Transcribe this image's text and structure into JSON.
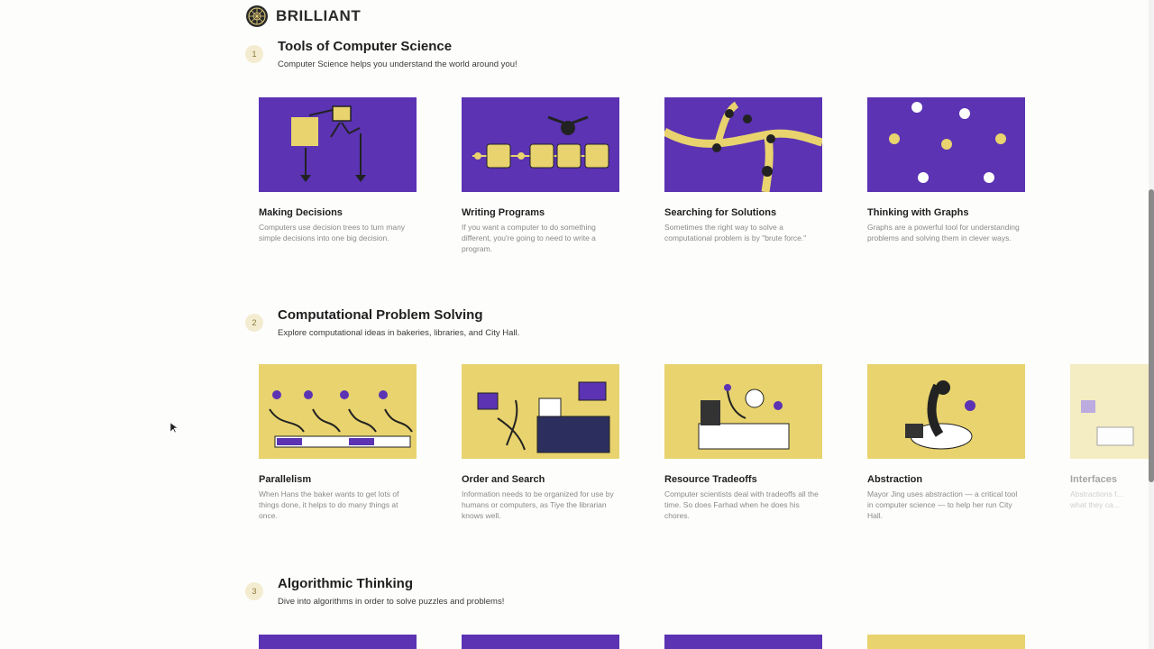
{
  "brand": {
    "name": "BRILLIANT",
    "logo_icon": "brilliant-logo-icon"
  },
  "colors": {
    "purple": "#5b33b3",
    "yellow": "#e8d36e",
    "accent_yellow": "#f0d85a"
  },
  "sections": [
    {
      "number": "1",
      "title": "Tools of Computer Science",
      "subtitle": "Computer Science helps you understand the world around you!",
      "cards": [
        {
          "title": "Making Decisions",
          "desc": "Computers use decision trees to turn many simple decisions into one big decision."
        },
        {
          "title": "Writing Programs",
          "desc": "If you want a computer to do something different, you're going to need to write a program."
        },
        {
          "title": "Searching for Solutions",
          "desc": "Sometimes the right way to solve a computational problem is by \"brute force.\""
        },
        {
          "title": "Thinking with Graphs",
          "desc": "Graphs are a powerful tool for understanding problems and solving them in clever ways."
        }
      ]
    },
    {
      "number": "2",
      "title": "Computational Problem Solving",
      "subtitle": "Explore computational ideas in bakeries, libraries, and City Hall.",
      "cards": [
        {
          "title": "Parallelism",
          "desc": "When Hans the baker wants to get lots of things done, it helps to do many things at once."
        },
        {
          "title": "Order and Search",
          "desc": "Information needs to be organized for use by humans or computers, as Tiye the librarian knows well."
        },
        {
          "title": "Resource Tradeoffs",
          "desc": "Computer scientists deal with tradeoffs all the time. So does Farhad when he does his chores."
        },
        {
          "title": "Abstraction",
          "desc": "Mayor Jing uses abstraction — a critical tool in computer science — to help her run City Hall."
        },
        {
          "title": "Interfaces",
          "desc": "Abstractions f... what they ca..."
        }
      ]
    },
    {
      "number": "3",
      "title": "Algorithmic Thinking",
      "subtitle": "Dive into algorithms in order to solve puzzles and problems!",
      "cards": []
    }
  ]
}
